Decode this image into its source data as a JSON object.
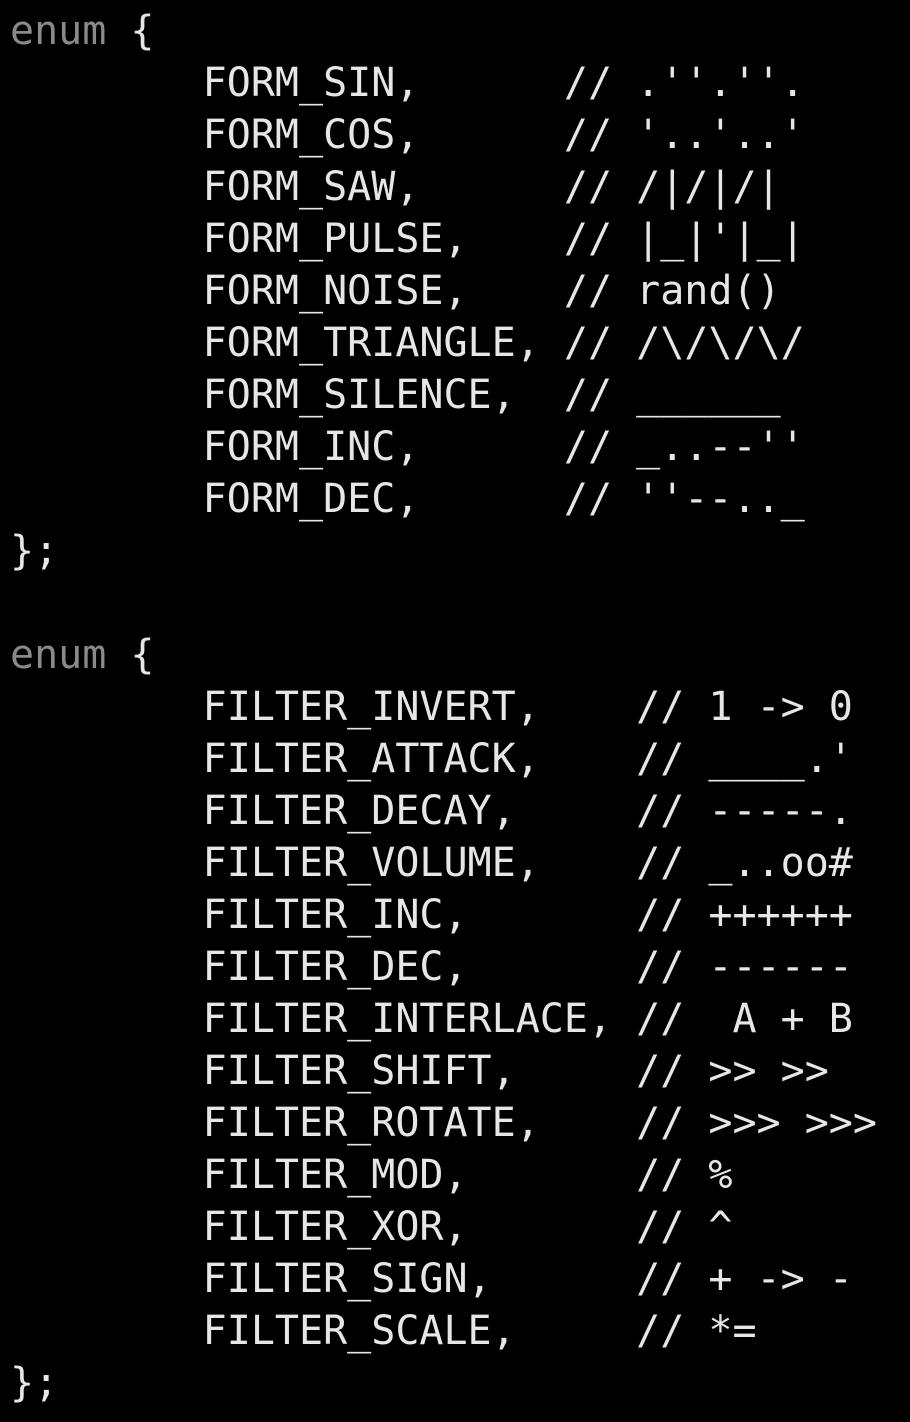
{
  "colors": {
    "background": "#000000",
    "text": "#e6e6e6",
    "keyword": "#8a8a8a"
  },
  "lines": [
    {
      "kw": "enum",
      "text": " {"
    },
    {
      "text": "        FORM_SIN,      // .''.''."
    },
    {
      "text": "        FORM_COS,      // '..'..'"
    },
    {
      "text": "        FORM_SAW,      // /|/|/|"
    },
    {
      "text": "        FORM_PULSE,    // |_|'|_|"
    },
    {
      "text": "        FORM_NOISE,    // rand()"
    },
    {
      "text": "        FORM_TRIANGLE, // /\\/\\/\\/"
    },
    {
      "text": "        FORM_SILENCE,  // ______"
    },
    {
      "text": "        FORM_INC,      // _..--''"
    },
    {
      "text": "        FORM_DEC,      // ''--.._"
    },
    {
      "text": "};"
    },
    {
      "text": ""
    },
    {
      "kw": "enum",
      "text": " {"
    },
    {
      "text": "        FILTER_INVERT,    // 1 -> 0"
    },
    {
      "text": "        FILTER_ATTACK,    // ____.'"
    },
    {
      "text": "        FILTER_DECAY,     // -----."
    },
    {
      "text": "        FILTER_VOLUME,    // _..oo#"
    },
    {
      "text": "        FILTER_INC,       // ++++++"
    },
    {
      "text": "        FILTER_DEC,       // ------"
    },
    {
      "text": "        FILTER_INTERLACE, //  A + B"
    },
    {
      "text": "        FILTER_SHIFT,     // >> >>"
    },
    {
      "text": "        FILTER_ROTATE,    // >>> >>>"
    },
    {
      "text": "        FILTER_MOD,       // %"
    },
    {
      "text": "        FILTER_XOR,       // ^"
    },
    {
      "text": "        FILTER_SIGN,      // + -> -"
    },
    {
      "text": "        FILTER_SCALE,     // *="
    },
    {
      "text": "};"
    }
  ]
}
